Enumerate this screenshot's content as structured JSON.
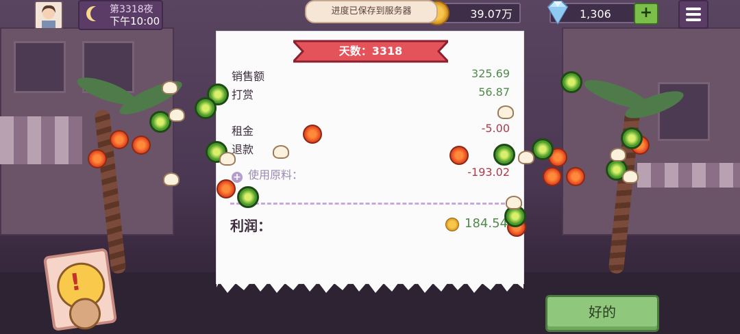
{
  "hud": {
    "night_label": "第3318夜",
    "time_label": "下午10:00",
    "toast": "进度已保存到服务器",
    "coins": "39.07万",
    "gems": "1,306",
    "plus": "+"
  },
  "receipt": {
    "banner": "天数：3318",
    "rows": [
      {
        "label": "销售额",
        "value": "325.69"
      },
      {
        "label": "打赏",
        "value": "56.87"
      },
      {
        "label": "租金",
        "value": "-5.00"
      },
      {
        "label": "退款",
        "value": ""
      },
      {
        "label": "使用原料：",
        "value": "-193.02"
      }
    ],
    "profit_label": "利润：",
    "profit_value": "184.54"
  },
  "buttons": {
    "ok": "好的",
    "alert": "!"
  },
  "colors": {
    "positive": "#4f8a4a",
    "negative": "#b0394a",
    "banner": "#e4525a",
    "ok_button": "#8fc87c"
  },
  "icons": [
    "moon-icon",
    "coin-icon",
    "gem-icon",
    "menu-icon",
    "plus-circle-icon",
    "alert-icon",
    "avatar"
  ]
}
